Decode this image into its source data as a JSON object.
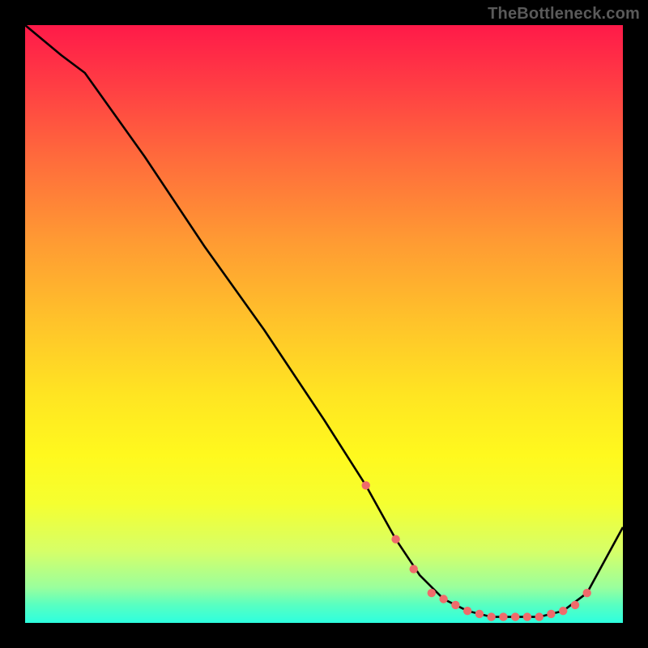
{
  "watermark": "TheBottleneck.com",
  "chart_data": {
    "type": "line",
    "title": "",
    "xlabel": "",
    "ylabel": "",
    "xlim": [
      0,
      100
    ],
    "ylim": [
      0,
      100
    ],
    "series": [
      {
        "name": "curve",
        "x": [
          0,
          6,
          10,
          20,
          30,
          40,
          50,
          57,
          62,
          66,
          70,
          74,
          78,
          82,
          86,
          90,
          94,
          100
        ],
        "y": [
          100,
          95,
          92,
          78,
          63,
          49,
          34,
          23,
          14,
          8,
          4,
          2,
          1,
          1,
          1,
          2,
          5,
          16
        ]
      }
    ],
    "markers": {
      "name": "dots",
      "x": [
        57,
        62,
        65,
        68,
        70,
        72,
        74,
        76,
        78,
        80,
        82,
        84,
        86,
        88,
        90,
        92,
        94
      ],
      "y": [
        23,
        14,
        9,
        5,
        4,
        3,
        2,
        1.5,
        1,
        1,
        1,
        1,
        1,
        1.5,
        2,
        3,
        5
      ]
    },
    "marker_color": "#ef6b6b",
    "line_color": "#000000"
  }
}
